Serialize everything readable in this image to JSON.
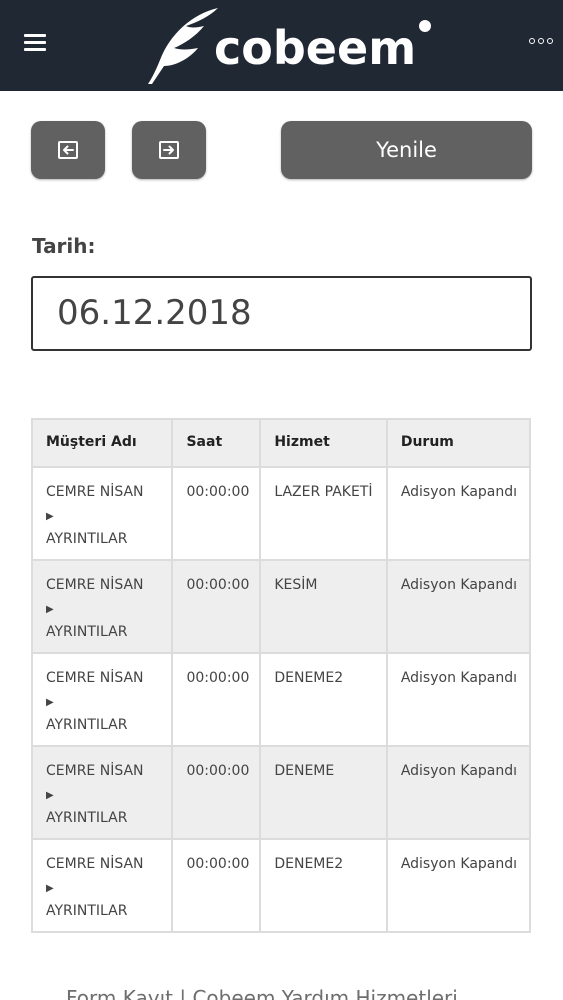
{
  "header": {
    "brand": "cobeem",
    "colors": {
      "bar": "#202833",
      "buttons": "#616161"
    }
  },
  "toolbar": {
    "prev_icon": "arrow-left-icon",
    "next_icon": "arrow-right-icon",
    "refresh_label": "Yenile"
  },
  "date": {
    "label": "Tarih:",
    "value": "06.12.2018"
  },
  "table": {
    "headers": [
      "Müşteri Adı",
      "Saat",
      "Hizmet",
      "Durum"
    ],
    "rows": [
      {
        "customer": "CEMRE NİSAN",
        "detail": "AYRINTILAR",
        "time": "00:00:00",
        "service": "LAZER PAKETİ",
        "status": "Adisyon Kapandı"
      },
      {
        "customer": "CEMRE NİSAN",
        "detail": "AYRINTILAR",
        "time": "00:00:00",
        "service": "KESİM",
        "status": "Adisyon Kapandı"
      },
      {
        "customer": "CEMRE NİSAN",
        "detail": "AYRINTILAR",
        "time": "00:00:00",
        "service": "DENEME2",
        "status": "Adisyon Kapandı"
      },
      {
        "customer": "CEMRE NİSAN",
        "detail": "AYRINTILAR",
        "time": "00:00:00",
        "service": "DENEME",
        "status": "Adisyon Kapandı"
      },
      {
        "customer": "CEMRE NİSAN",
        "detail": "AYRINTILAR",
        "time": "00:00:00",
        "service": "DENEME2",
        "status": "Adisyon Kapandı"
      }
    ]
  },
  "footer": {
    "text": "Form Kayıt | Cobeem Yardım Hizmetleri"
  }
}
